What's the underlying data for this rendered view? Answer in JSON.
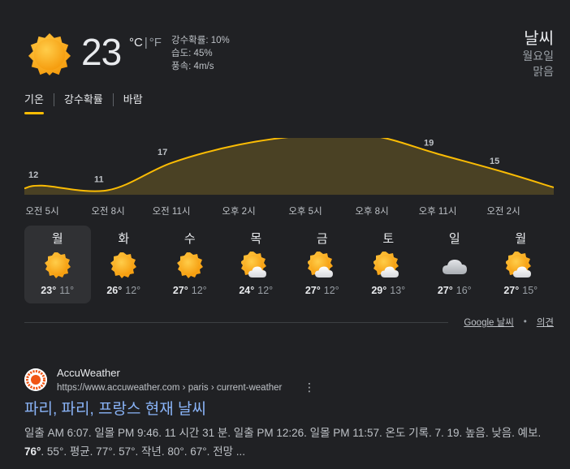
{
  "current": {
    "temperature": "23",
    "unit_c": "°C",
    "unit_sep": "|",
    "unit_f": "°F",
    "precip": "강수확률: 10%",
    "humidity": "습도: 45%",
    "wind": "풍속: 4m/s",
    "icon": "sunny-icon"
  },
  "location": {
    "title": "날씨",
    "day": "월요일",
    "condition": "맑음"
  },
  "tabs": [
    {
      "label": "기온",
      "active": true
    },
    {
      "label": "강수확률",
      "active": false
    },
    {
      "label": "바람",
      "active": false
    }
  ],
  "chart_data": {
    "type": "area",
    "x": [
      "오전 5시",
      "오전 8시",
      "오전 11시",
      "오후 2시",
      "오후 5시",
      "오후 8시",
      "오후 11시",
      "오전 2시"
    ],
    "values": [
      12,
      11,
      17,
      21,
      23,
      23,
      19,
      15
    ],
    "color": "#fbbc04",
    "fill": "#4a4124",
    "grid": false
  },
  "days": [
    {
      "name": "월",
      "high": "23°",
      "low": "11°",
      "icon": "sunny-icon",
      "selected": true
    },
    {
      "name": "화",
      "high": "26°",
      "low": "12°",
      "icon": "sunny-icon",
      "selected": false
    },
    {
      "name": "수",
      "high": "27°",
      "low": "12°",
      "icon": "sunny-icon",
      "selected": false
    },
    {
      "name": "목",
      "high": "24°",
      "low": "12°",
      "icon": "partly-cloudy-icon",
      "selected": false
    },
    {
      "name": "금",
      "high": "27°",
      "low": "12°",
      "icon": "partly-cloudy-icon",
      "selected": false
    },
    {
      "name": "토",
      "high": "29°",
      "low": "13°",
      "icon": "partly-cloudy-icon",
      "selected": false
    },
    {
      "name": "일",
      "high": "27°",
      "low": "16°",
      "icon": "cloudy-icon",
      "selected": false
    },
    {
      "name": "월",
      "high": "27°",
      "low": "15°",
      "icon": "partly-cloudy-icon",
      "selected": false
    }
  ],
  "footer": {
    "source_link": "Google 날씨",
    "dot": "•",
    "feedback": "의견"
  },
  "result": {
    "site": "AccuWeather",
    "url": "https://www.accuweather.com › paris › current-weather",
    "menu": "⋮",
    "title": "파리, 파리, 프랑스 현재 날씨",
    "snippet_before": "일출 AM 6:07. 일몰 PM 9:46. 11 시간 31 분. 일출 PM 12:26. 일몰 PM 11:57. 온도 기록. 7. 19. 높음. 낮음. 예보. ",
    "snippet_bold": "76°",
    "snippet_after": ". 55°. 평균. 77°. 57°. 작년. 80°. 67°. 전망 ...",
    "logo_color": "#f05514"
  }
}
